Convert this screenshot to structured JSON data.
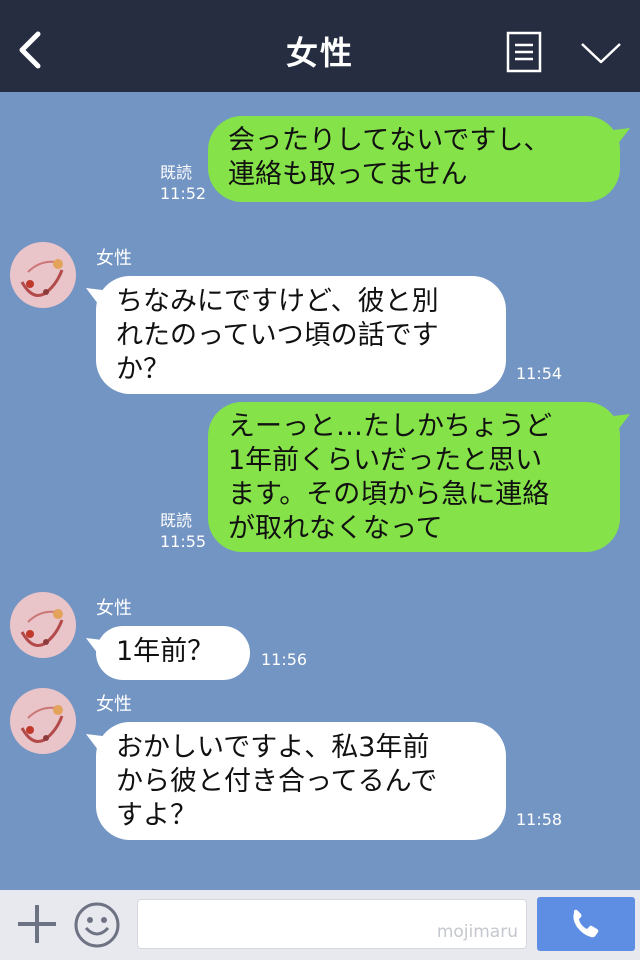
{
  "header": {
    "title": "女性"
  },
  "messages": [
    {
      "direction": "out",
      "text": "会ったりしてないですし、\n連絡も取ってません",
      "read": "既読",
      "time": "11:52"
    },
    {
      "direction": "in",
      "sender": "女性",
      "text": "ちなみにですけど、彼と別\nれたのっていつ頃の話です\nか？",
      "time": "11:54"
    },
    {
      "direction": "out",
      "text": "えーっと…たしかちょうど\n1年前くらいだったと思い\nます。その頃から急に連絡\nが取れなくなって",
      "read": "既読",
      "time": "11:55"
    },
    {
      "direction": "in",
      "sender": "女性",
      "text": "1年前？",
      "time": "11:56"
    },
    {
      "direction": "in",
      "sender": "女性",
      "text": "おかしいですよ、私3年前\nから彼と付き合ってるんで\nすよ？",
      "time": "11:58"
    }
  ],
  "footer": {
    "input_value": "",
    "watermark": "mojimaru"
  },
  "colors": {
    "header_bg": "#262d40",
    "chat_bg": "#7395c3",
    "out_bubble": "#85e249",
    "in_bubble": "#ffffff",
    "call_button": "#5e8ee4"
  }
}
